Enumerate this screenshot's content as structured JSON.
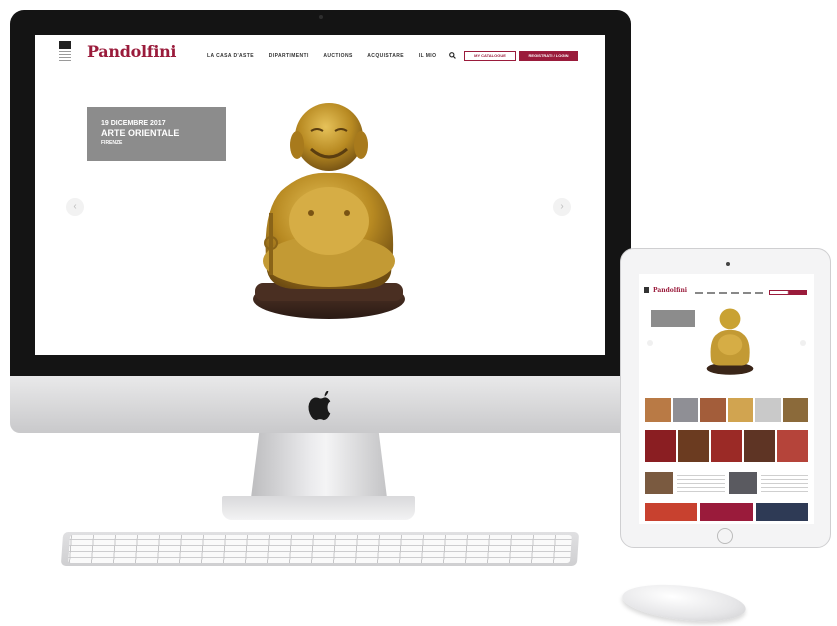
{
  "site": {
    "logo": "Pandolfini",
    "nav": [
      "LA CASA D'ASTE",
      "DIPARTIMENTI",
      "AUCTIONS",
      "ACQUISTARE",
      "IL MIO"
    ],
    "icon_search": "search-icon",
    "btn_outline": "MY CATALOGUE",
    "btn_solid": "REGISTRATI / LOGIN",
    "brand_color": "#9a1b3b"
  },
  "hero": {
    "date": "19 DICEMBRE 2017",
    "title": "ARTE ORIENTALE",
    "place": "FIRENZE",
    "prev": "‹",
    "next": "›",
    "image": "golden-buddha-statue"
  },
  "ipad": {
    "logo": "Pandolfini"
  },
  "colors": {
    "caption_bg": "#8c8c8c",
    "gold": "#c9a233",
    "bezel": "#141414"
  }
}
